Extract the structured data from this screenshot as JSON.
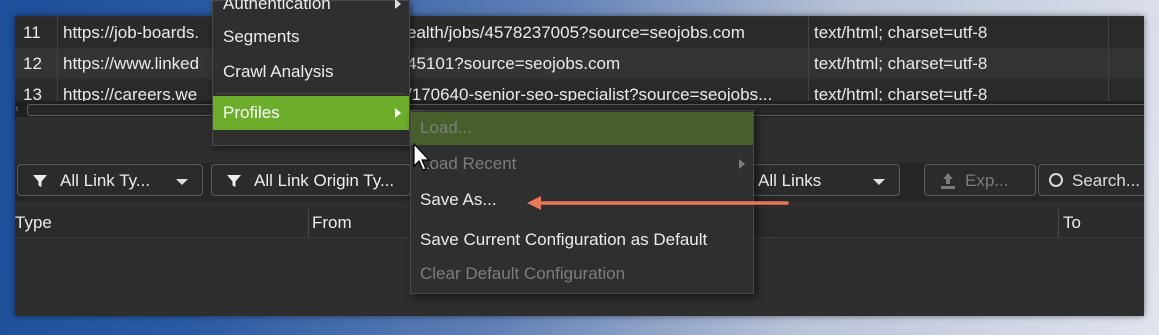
{
  "table": {
    "rows": [
      {
        "num": "11",
        "url": "https://job-boards.",
        "tail": "ealth/jobs/4578237005?source=seojobs.com",
        "content_type": "text/html; charset=utf-8"
      },
      {
        "num": "12",
        "url": "https://www.linked",
        "tail": "45101?source=seojobs.com",
        "content_type": "text/html; charset=utf-8"
      },
      {
        "num": "13",
        "url": "https://careers.we",
        "tail": "/170640-senior-seo-specialist?source=seojobs...",
        "content_type": "text/html; charset=utf-8"
      }
    ]
  },
  "main_menu": {
    "items": [
      {
        "label": "Authentication",
        "submenu": true
      },
      {
        "label": "Segments"
      },
      {
        "label": "Crawl Analysis"
      },
      {
        "label": "Profiles",
        "submenu": true,
        "highlighted": true
      }
    ]
  },
  "profiles_submenu": {
    "items": [
      {
        "label": "Load...",
        "disabled": true
      },
      {
        "label": "Load Recent",
        "disabled": true,
        "submenu": true
      },
      {
        "label": "Save As..."
      },
      {
        "label": "Save Current Configuration as Default"
      },
      {
        "label": "Clear Default Configuration",
        "disabled": true
      }
    ]
  },
  "filters": {
    "link_type": "All Link Ty...",
    "link_origin": "All Link Origin Ty...",
    "links": "All Links",
    "export_label": "Exp...",
    "search_placeholder": "Search..."
  },
  "bottom_table": {
    "headers": {
      "type": "Type",
      "from": "From",
      "to": "To"
    }
  },
  "colors": {
    "highlight": "#6cae2c",
    "highlight_dim": "#475f2a",
    "panel": "#2e2e2e",
    "annotation_arrow": "#e8785a"
  },
  "icons": [
    "funnel-icon",
    "chevron-down-icon",
    "chevron-right-icon",
    "export-icon",
    "search-icon",
    "mouse-cursor-icon",
    "annotation-arrow-icon"
  ]
}
